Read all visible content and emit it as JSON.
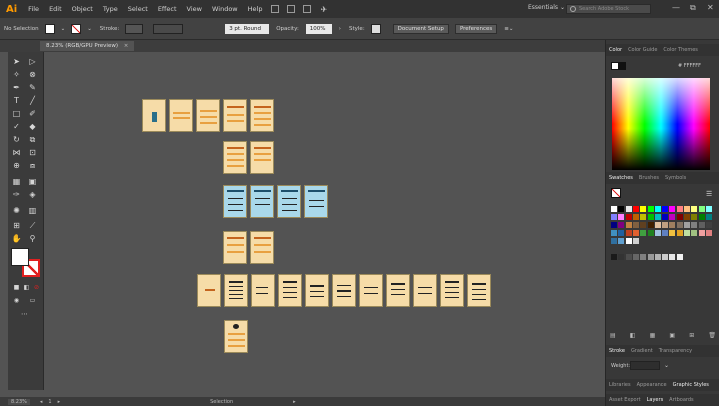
{
  "app": {
    "logo": "Ai"
  },
  "menu": [
    "File",
    "Edit",
    "Object",
    "Type",
    "Select",
    "Effect",
    "View",
    "Window",
    "Help"
  ],
  "workspace": "Essentials",
  "search_placeholder": "Search Adobe Stock",
  "window_controls": {
    "minimize": "—",
    "restore": "⧉",
    "close": "✕"
  },
  "control_bar": {
    "selection_label": "No Selection",
    "stroke_label": "Stroke:",
    "brush": "3 pt. Round",
    "opacity_label": "Opacity:",
    "opacity_value": "100%",
    "style_label": "Style:",
    "document_setup": "Document Setup",
    "preferences": "Preferences"
  },
  "document_tab": {
    "title": "8.23% (RGB/GPU Preview)",
    "close": "×"
  },
  "status_bar": {
    "zoom": "8.23%",
    "page": "1",
    "tool": "Selection"
  },
  "panels": {
    "color_tabs": [
      "Color",
      "Color Guide",
      "Color Themes"
    ],
    "hex_value": "FFFFFF",
    "swatch_tabs": [
      "Swatches",
      "Brushes",
      "Symbols"
    ],
    "stroke_tabs": [
      "Stroke",
      "Gradient",
      "Transparency"
    ],
    "weight_label": "Weight:",
    "graphic_tabs": [
      "Libraries",
      "Appearance",
      "Graphic Styles"
    ],
    "layer_tabs": [
      "Asset Export",
      "Layers",
      "Artboards"
    ]
  },
  "colors": {
    "accent_orange": "#ff9a00",
    "artboard_orange": "#f6dca8",
    "artboard_blue": "#a9d8ea",
    "canvas": "#535353",
    "panel": "#383838"
  }
}
